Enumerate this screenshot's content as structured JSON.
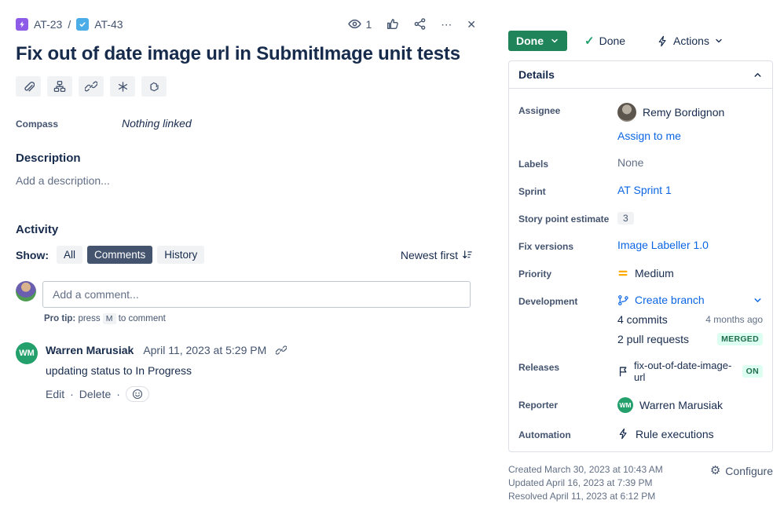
{
  "colors": {
    "done": "#1F845A",
    "link": "#0C66E4",
    "epic": "#8D5BE8",
    "task": "#4BADE8",
    "priority": "#FFAB00",
    "badgebg": "#DCFFF1",
    "badgetext": "#216E4E",
    "avgreen": "#23A06B"
  },
  "icons": {
    "close": "✕",
    "more": "⋯",
    "check": "✓",
    "dot": "·",
    "gear": "⚙"
  },
  "breadcrumb": {
    "parent": "AT-23",
    "separator": "/",
    "current": "AT-43"
  },
  "header": {
    "title": "Fix out of date image url in SubmitImage unit tests",
    "watch_count": "1"
  },
  "compass": {
    "label": "Compass",
    "value": "Nothing linked"
  },
  "description": {
    "heading": "Description",
    "placeholder": "Add a description..."
  },
  "activity": {
    "heading": "Activity",
    "show_label": "Show:",
    "tabs": [
      {
        "label": "All",
        "active": false
      },
      {
        "label": "Comments",
        "active": true
      },
      {
        "label": "History",
        "active": false
      }
    ],
    "sort_label": "Newest first"
  },
  "composer": {
    "placeholder": "Add a comment...",
    "pro_tip_prefix": "Pro tip:",
    "pro_tip_press": "press",
    "pro_tip_key": "M",
    "pro_tip_suffix": "to comment"
  },
  "comment": {
    "author": "Warren Marusiak",
    "author_initials": "WM",
    "timestamp": "April 11, 2023 at 5:29 PM",
    "body": "updating status to In Progress",
    "edit_label": "Edit",
    "delete_label": "Delete"
  },
  "status": {
    "status_label": "Done",
    "resolution_label": "Done",
    "actions_label": "Actions"
  },
  "details": {
    "heading": "Details",
    "assignee": {
      "label": "Assignee",
      "name": "Remy Bordignon",
      "assign_link": "Assign to me"
    },
    "labels": {
      "label": "Labels",
      "value": "None"
    },
    "sprint": {
      "label": "Sprint",
      "value": "AT Sprint 1"
    },
    "story_points": {
      "label": "Story point estimate",
      "value": "3"
    },
    "fix_versions": {
      "label": "Fix versions",
      "value": "Image Labeller 1.0"
    },
    "priority": {
      "label": "Priority",
      "value": "Medium"
    },
    "development": {
      "label": "Development",
      "create_branch": "Create branch",
      "commits": "4 commits",
      "commits_age": "4 months ago",
      "pull_requests": "2 pull requests",
      "pr_status": "MERGED"
    },
    "releases": {
      "label": "Releases",
      "value": "fix-out-of-date-image-url",
      "badge": "ON"
    },
    "reporter": {
      "label": "Reporter",
      "name": "Warren Marusiak",
      "initials": "WM"
    },
    "automation": {
      "label": "Automation",
      "value": "Rule executions"
    }
  },
  "footer": {
    "created": "Created March 30, 2023 at 10:43 AM",
    "updated": "Updated April 16, 2023 at 7:39 PM",
    "resolved": "Resolved April 11, 2023 at 6:12 PM",
    "configure_label": "Configure"
  }
}
